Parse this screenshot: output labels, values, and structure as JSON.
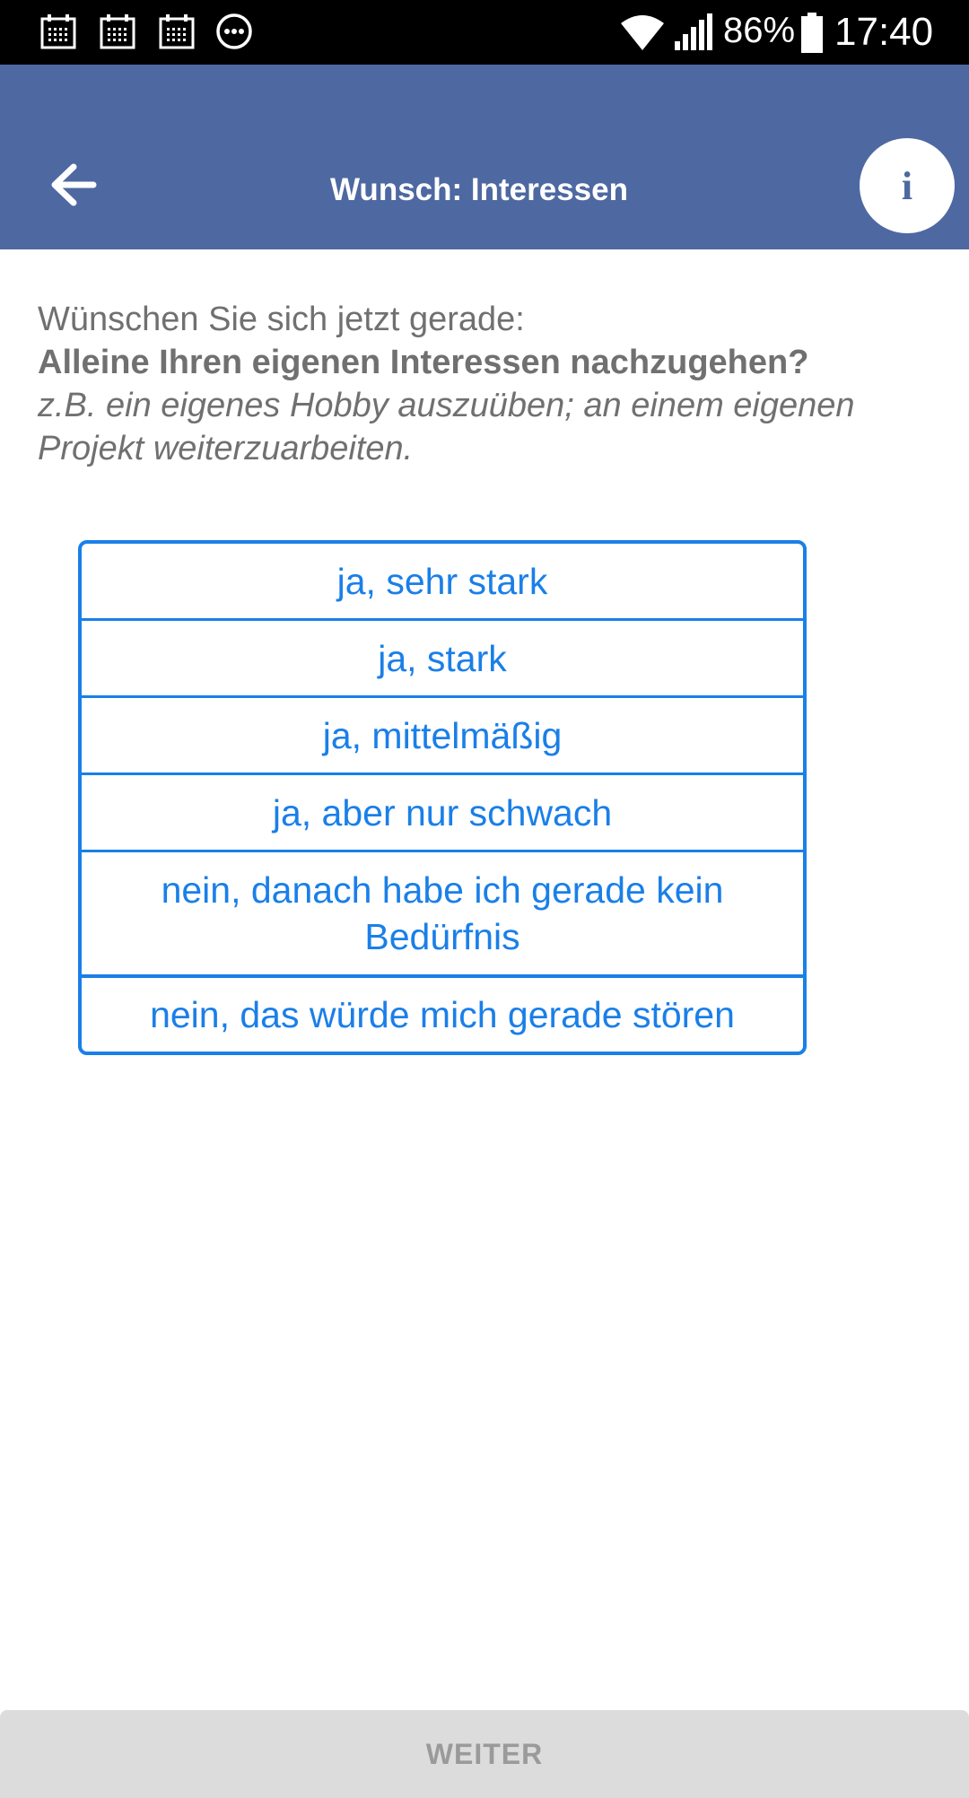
{
  "status_bar": {
    "notification_icons": [
      "calendar-icon",
      "calendar-icon",
      "calendar-icon",
      "more-circle-icon"
    ],
    "battery": "86%",
    "time": "17:40"
  },
  "app_bar": {
    "title": "Wunsch: Interessen",
    "back_icon": "arrow-left-icon",
    "info_icon_glyph": "i",
    "background_color": "#4e68a1"
  },
  "question": {
    "intro": "Wünschen Sie sich jetzt gerade:",
    "main": "Alleine Ihren eigenen Interessen nachzugehen?",
    "example": "z.B. ein eigenes Hobby auszuüben; an einem eigenen Projekt weiterzuarbeiten."
  },
  "options": [
    "ja, sehr stark",
    "ja, stark",
    "ja, mittelmäßig",
    "ja, aber nur schwach",
    "nein, danach habe ich gerade kein Bedürfnis",
    "nein, das würde mich gerade stören"
  ],
  "accent_color": "#1a7fe8",
  "next_button": {
    "label": "WEITER",
    "enabled": false
  }
}
